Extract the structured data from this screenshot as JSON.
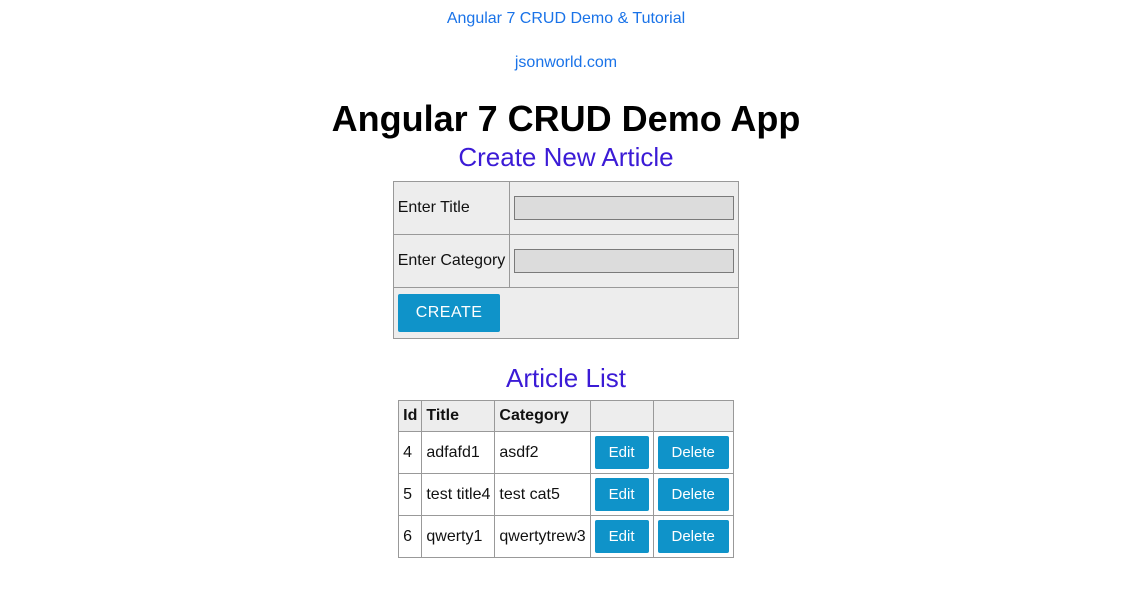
{
  "header": {
    "link1": "Angular 7 CRUD Demo & Tutorial",
    "link2": "jsonworld.com",
    "page_title": "Angular 7 CRUD Demo App"
  },
  "form": {
    "heading": "Create New Article",
    "title_label": "Enter Title",
    "title_value": "",
    "category_label": "Enter Category",
    "category_value": "",
    "create_button": "CREATE"
  },
  "list": {
    "heading": "Article List",
    "columns": {
      "id": "Id",
      "title": "Title",
      "category": "Category"
    },
    "edit_label": "Edit",
    "delete_label": "Delete",
    "rows": [
      {
        "id": "4",
        "title": "adfafd1",
        "category": "asdf2"
      },
      {
        "id": "5",
        "title": "test title4",
        "category": "test cat5"
      },
      {
        "id": "6",
        "title": "qwerty1",
        "category": "qwertytrew3"
      }
    ]
  }
}
